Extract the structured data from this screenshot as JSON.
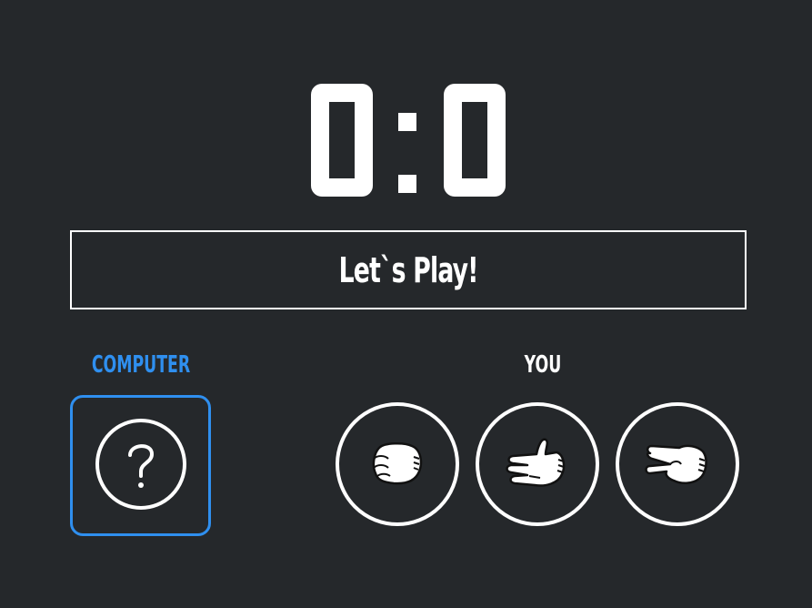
{
  "score": {
    "computer": "0",
    "separator": ":",
    "player": "0"
  },
  "message": "Let`s Play!",
  "computer": {
    "label": "COMPUTER",
    "choice_icon": "question-mark-icon"
  },
  "player": {
    "label": "YOU",
    "choices": [
      {
        "name": "rock",
        "icon": "fist-hand-icon"
      },
      {
        "name": "paper",
        "icon": "open-hand-icon"
      },
      {
        "name": "scissors",
        "icon": "scissors-hand-icon"
      }
    ]
  },
  "colors": {
    "background": "#25282b",
    "accent": "#2f8fef",
    "foreground": "#ffffff"
  }
}
